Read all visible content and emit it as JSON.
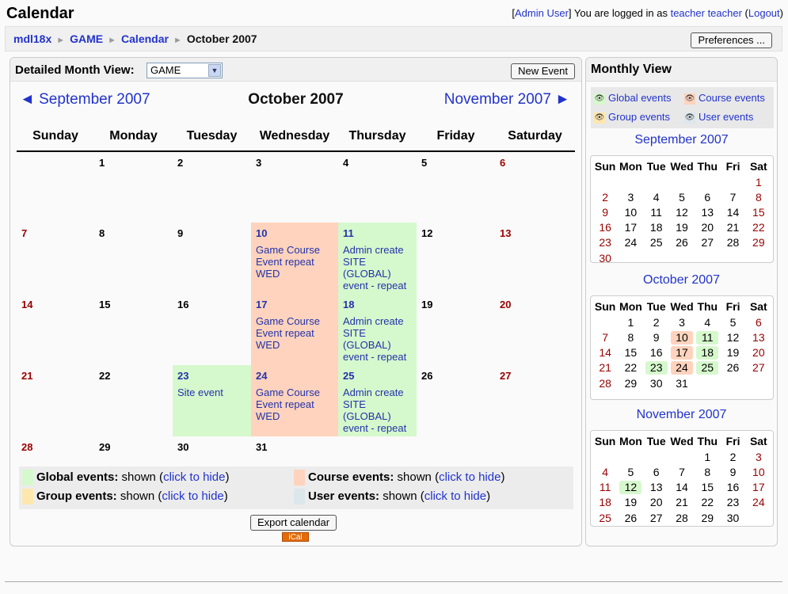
{
  "header": {
    "title": "Calendar",
    "login_prefix": "[",
    "admin_user": "Admin User",
    "login_mid": "] You are logged in as ",
    "user_name": "teacher teacher",
    "logout": "Logout"
  },
  "breadcrumb": {
    "items": [
      "mdl18x",
      "GAME",
      "Calendar"
    ],
    "current": "October 2007",
    "separator": "►"
  },
  "preferences_button": "Preferences ...",
  "main": {
    "detail_label": "Detailed Month View:",
    "course_selected": "GAME",
    "new_event_button": "New Event",
    "prev_month": "◄ September 2007",
    "current_month": "October 2007",
    "next_month": "November 2007 ►",
    "weekdays": [
      "Sunday",
      "Monday",
      "Tuesday",
      "Wednesday",
      "Thursday",
      "Friday",
      "Saturday"
    ],
    "weeks": [
      [
        {
          "d": ""
        },
        {
          "d": "1"
        },
        {
          "d": "2"
        },
        {
          "d": "3"
        },
        {
          "d": "4"
        },
        {
          "d": "5"
        },
        {
          "d": "6",
          "we": true
        }
      ],
      [
        {
          "d": "7",
          "we": true
        },
        {
          "d": "8"
        },
        {
          "d": "9"
        },
        {
          "d": "10",
          "type": "course",
          "ev": "Game Course Event repeat WED"
        },
        {
          "d": "11",
          "type": "global",
          "ev": "Admin create SITE (GLOBAL) event - repeat"
        },
        {
          "d": "12"
        },
        {
          "d": "13",
          "we": true
        }
      ],
      [
        {
          "d": "14",
          "we": true
        },
        {
          "d": "15"
        },
        {
          "d": "16"
        },
        {
          "d": "17",
          "type": "course",
          "ev": "Game Course Event repeat WED"
        },
        {
          "d": "18",
          "type": "global",
          "ev": "Admin create SITE (GLOBAL) event - repeat"
        },
        {
          "d": "19"
        },
        {
          "d": "20",
          "we": true
        }
      ],
      [
        {
          "d": "21",
          "we": true
        },
        {
          "d": "22"
        },
        {
          "d": "23",
          "type": "global",
          "ev": "Site event"
        },
        {
          "d": "24",
          "type": "course",
          "ev": "Game Course Event repeat WED"
        },
        {
          "d": "25",
          "type": "global",
          "ev": "Admin create SITE (GLOBAL) event - repeat"
        },
        {
          "d": "26"
        },
        {
          "d": "27",
          "we": true
        }
      ],
      [
        {
          "d": "28",
          "we": true
        },
        {
          "d": "29"
        },
        {
          "d": "30"
        },
        {
          "d": "31"
        },
        {
          "d": ""
        },
        {
          "d": ""
        },
        {
          "d": ""
        }
      ]
    ],
    "legend": {
      "global_label": "Global events:",
      "course_label": "Course events:",
      "group_label": "Group events:",
      "user_label": "User events:",
      "shown": " shown (",
      "hide_link": "click to hide",
      "close": ")"
    },
    "export_button": "Export calendar",
    "ical_badge": "iCal"
  },
  "sidebar": {
    "title": "Monthly View",
    "legend": {
      "global": "Global events",
      "course": "Course events",
      "group": "Group events",
      "user": "User events"
    },
    "day_abbr": [
      "Sun",
      "Mon",
      "Tue",
      "Wed",
      "Thu",
      "Fri",
      "Sat"
    ],
    "months": [
      {
        "name": "September 2007",
        "rows": [
          [
            "",
            "",
            "",
            "",
            "",
            "",
            "1"
          ],
          [
            "2",
            "3",
            "4",
            "5",
            "6",
            "7",
            "8"
          ],
          [
            "9",
            "10",
            "11",
            "12",
            "13",
            "14",
            "15"
          ],
          [
            "16",
            "17",
            "18",
            "19",
            "20",
            "21",
            "22"
          ],
          [
            "23",
            "24",
            "25",
            "26",
            "27",
            "28",
            "29"
          ],
          [
            "30",
            "",
            "",
            "",
            "",
            "",
            ""
          ]
        ],
        "course_days": [],
        "global_days": []
      },
      {
        "name": "October 2007",
        "rows": [
          [
            "",
            "1",
            "2",
            "3",
            "4",
            "5",
            "6"
          ],
          [
            "7",
            "8",
            "9",
            "10",
            "11",
            "12",
            "13"
          ],
          [
            "14",
            "15",
            "16",
            "17",
            "18",
            "19",
            "20"
          ],
          [
            "21",
            "22",
            "23",
            "24",
            "25",
            "26",
            "27"
          ],
          [
            "28",
            "29",
            "30",
            "31",
            "",
            "",
            ""
          ]
        ],
        "course_days": [
          "10",
          "17",
          "24"
        ],
        "global_days": [
          "11",
          "18",
          "23",
          "25"
        ]
      },
      {
        "name": "November 2007",
        "rows": [
          [
            "",
            "",
            "",
            "",
            "1",
            "2",
            "3"
          ],
          [
            "4",
            "5",
            "6",
            "7",
            "8",
            "9",
            "10"
          ],
          [
            "11",
            "12",
            "13",
            "14",
            "15",
            "16",
            "17"
          ],
          [
            "18",
            "19",
            "20",
            "21",
            "22",
            "23",
            "24"
          ],
          [
            "25",
            "26",
            "27",
            "28",
            "29",
            "30",
            ""
          ]
        ],
        "course_days": [],
        "global_days": [
          "12"
        ]
      }
    ]
  },
  "colors": {
    "course": "#ffd3bd",
    "global": "#d6f8cd",
    "group": "#fee7ae",
    "user": "#dce7ec",
    "link": "#2233cc",
    "weekend": "#990000"
  }
}
